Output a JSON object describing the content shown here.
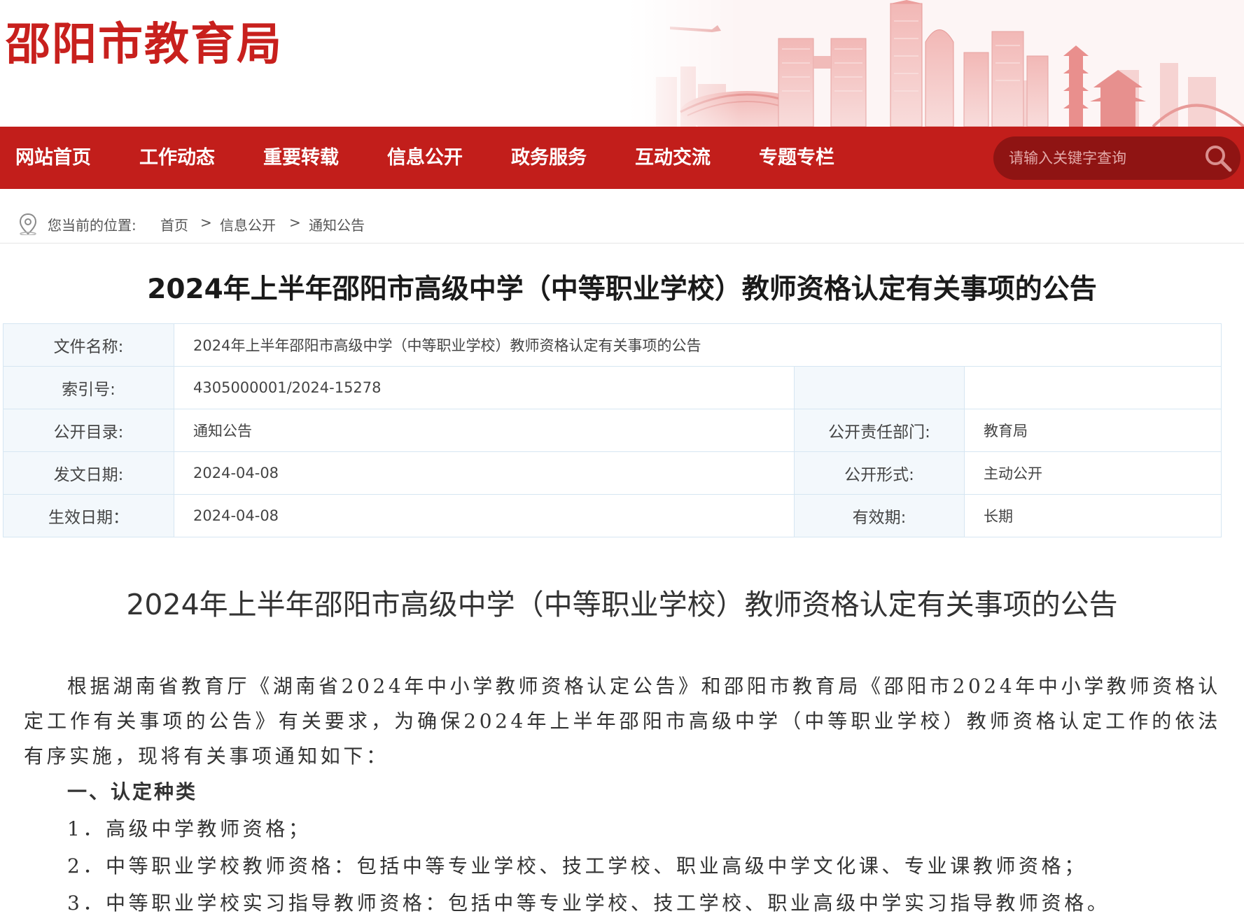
{
  "header": {
    "site_title": "邵阳市教育局",
    "brand_color": "#c21e1b"
  },
  "nav": {
    "items": [
      {
        "label": "网站首页"
      },
      {
        "label": "工作动态"
      },
      {
        "label": "重要转载"
      },
      {
        "label": "信息公开"
      },
      {
        "label": "政务服务"
      },
      {
        "label": "互动交流"
      },
      {
        "label": "专题专栏"
      }
    ],
    "search_placeholder": "请输入关键字查询",
    "search_icon": "search-icon"
  },
  "breadcrumb": {
    "prefix": "您当前的位置:",
    "items": [
      "首页",
      "信息公开",
      "通知公告"
    ],
    "separator": ">",
    "icon": "location-pin-icon"
  },
  "headline": "2024年上半年邵阳市高级中学（中等职业学校）教师资格认定有关事项的公告",
  "info_table": {
    "file_name_label": "文件名称:",
    "file_name_value": "2024年上半年邵阳市高级中学（中等职业学校）教师资格认定有关事项的公告",
    "index_label": "索引号:",
    "index_value": "4305000001/2024-15278",
    "catalog_label": "公开目录:",
    "catalog_value": "通知公告",
    "dept_label": "公开责任部门:",
    "dept_value": "教育局",
    "issue_date_label": "发文日期:",
    "issue_date_value": "2024-04-08",
    "form_label": "公开形式:",
    "form_value": "主动公开",
    "effective_date_label": "生效日期：",
    "effective_date_value": "2024-04-08",
    "validity_label": "有效期:",
    "validity_value": "长期"
  },
  "article": {
    "title": "2024年上半年邵阳市高级中学（中等职业学校）教师资格认定有关事项的公告",
    "intro": "根据湖南省教育厅《湖南省2024年中小学教师资格认定公告》和邵阳市教育局《邵阳市2024年中小学教师资格认定工作有关事项的公告》有关要求，为确保2024年上半年邵阳市高级中学（中等职业学校）教师资格认定工作的依法有序实施，现将有关事项通知如下：",
    "section1_heading": "一、认定种类",
    "section1_items": [
      "1．高级中学教师资格；",
      "2．中等职业学校教师资格：包括中等专业学校、技工学校、职业高级中学文化课、专业课教师资格；",
      "3．中等职业学校实习指导教师资格：包括中等专业学校、技工学校、职业高级中学实习指导教师资格。"
    ]
  }
}
